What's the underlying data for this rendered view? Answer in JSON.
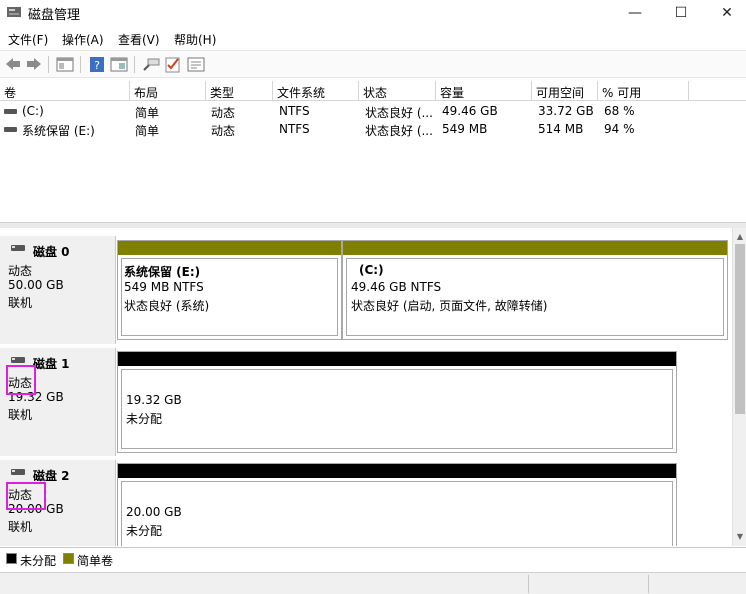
{
  "window": {
    "title": "磁盘管理",
    "minimize": "—",
    "maximize": "☐",
    "close": "✕"
  },
  "menu": [
    "文件(F)",
    "操作(A)",
    "查看(V)",
    "帮助(H)"
  ],
  "toolbar_icons": [
    "back-arrow-icon",
    "forward-arrow-icon",
    "properties-icon",
    "help-icon",
    "console-icon",
    "search-icon",
    "check-icon",
    "list-icon"
  ],
  "volumes": {
    "headers": [
      "卷",
      "布局",
      "类型",
      "文件系统",
      "状态",
      "容量",
      "可用空间",
      "% 可用"
    ],
    "rows": [
      [
        "(C:)",
        "简单",
        "动态",
        "NTFS",
        "状态良好 (...",
        "49.46 GB",
        "33.72 GB",
        "68 %"
      ],
      [
        "系统保留 (E:)",
        "简单",
        "动态",
        "NTFS",
        "状态良好 (...",
        "549 MB",
        "514 MB",
        "94 %"
      ]
    ]
  },
  "disks": [
    {
      "name": "磁盘 0",
      "type": "动态",
      "size": "50.00 GB",
      "status": "联机",
      "partitions": [
        {
          "title": "系统保留  (E:)",
          "fs": "549 MB NTFS",
          "state": "状态良好 (系统)",
          "kind": "simple"
        },
        {
          "title": "(C:)",
          "fs": "49.46 GB NTFS",
          "state": "状态良好 (启动, 页面文件, 故障转储)",
          "kind": "simple"
        }
      ]
    },
    {
      "name": "磁盘 1",
      "type": "动态",
      "size": "19.32 GB",
      "status": "联机",
      "partitions": [
        {
          "size": "19.32 GB",
          "state": "未分配",
          "kind": "unallocated"
        }
      ]
    },
    {
      "name": "磁盘 2",
      "type": "动态",
      "size": "20.00 GB",
      "status": "联机",
      "partitions": [
        {
          "size": "20.00 GB",
          "state": "未分配",
          "kind": "unallocated"
        }
      ]
    }
  ],
  "legend": [
    {
      "label": "未分配",
      "color": "#000000"
    },
    {
      "label": "简单卷",
      "color": "#808000"
    }
  ],
  "colors": {
    "simple": "#808000",
    "unallocated": "#000000",
    "highlight": "#e020e0"
  }
}
